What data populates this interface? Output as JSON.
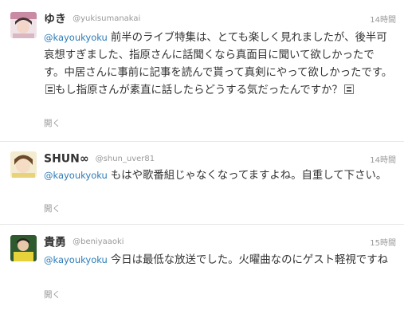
{
  "tweets": [
    {
      "fullname": "ゆき",
      "username": "@yukisumanakai",
      "time": "14時間",
      "mention": "@kayoukyoku",
      "text_1": "前半のライブ特集は、とても楽しく見れましたが、後半可哀想すぎました、指原さんに話聞くなら真面目に聞いて欲しかったです。中居さんに事前に記事を読んで貰って真剣にやって欲しかったです。",
      "text_2": "もし指原さんが素直に話したらどうする気だったんですか？",
      "expand": "開く",
      "avatar_color": "#d9b8c4"
    },
    {
      "fullname": "SHUN∞",
      "username": "@shun_uver81",
      "time": "14時間",
      "mention": "@kayoukyoku",
      "text_1": "もはや歌番組じゃなくなってますよね。自重して下さい。",
      "expand": "開く",
      "avatar_color": "#e8d27a"
    },
    {
      "fullname": "貴勇",
      "username": "@beniyaaoki",
      "time": "15時間",
      "mention": "@kayoukyoku",
      "text_1": "今日は最低な放送でした。火曜曲なのにゲスト軽視ですね",
      "expand": "開く",
      "avatar_color": "#3a6b3a"
    }
  ],
  "colors": {
    "link": "#2b7bb9",
    "muted": "#999999",
    "text": "#333333"
  },
  "icons": [
    "emoji-icon"
  ]
}
